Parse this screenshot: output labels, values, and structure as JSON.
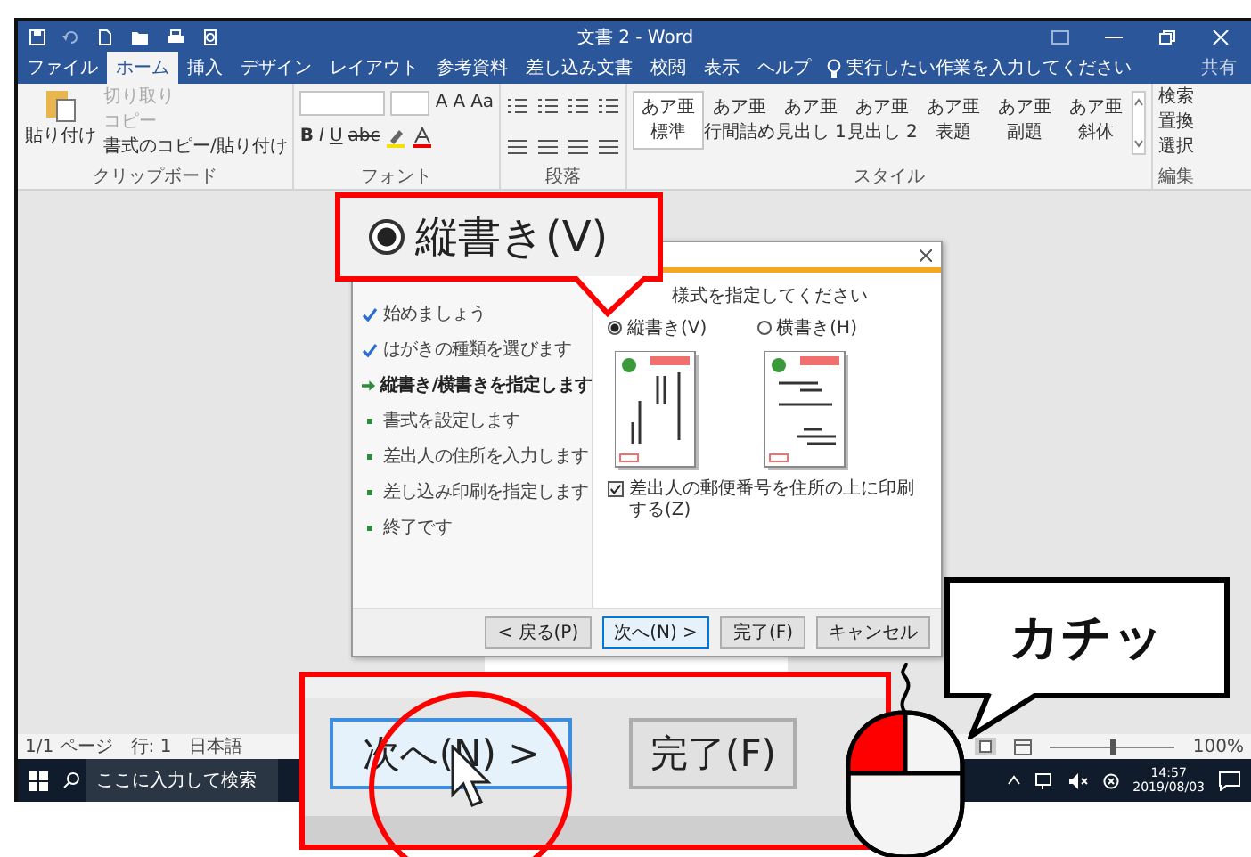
{
  "title_bar": {
    "title": "文書 2 - Word"
  },
  "ribbon_tabs": [
    {
      "label": "ファイル",
      "selected": false
    },
    {
      "label": "ホーム",
      "selected": true
    },
    {
      "label": "挿入",
      "selected": false
    },
    {
      "label": "デザイン",
      "selected": false
    },
    {
      "label": "レイアウト",
      "selected": false
    },
    {
      "label": "参考資料",
      "selected": false
    },
    {
      "label": "差し込み文書",
      "selected": false
    },
    {
      "label": "校閲",
      "selected": false
    },
    {
      "label": "表示",
      "selected": false
    },
    {
      "label": "ヘルプ",
      "selected": false
    }
  ],
  "tell_me": {
    "placeholder": "実行したい作業を入力してください"
  },
  "share": "共有",
  "clipboard": {
    "paste": "貼り付け",
    "label": "クリップボード",
    "items": [
      {
        "label": "切り取り",
        "disabled": true
      },
      {
        "label": "コピー",
        "disabled": true
      },
      {
        "label": "書式のコピー/貼り付け",
        "disabled": false
      }
    ]
  },
  "font": {
    "label": "フォント",
    "size_buttons": [
      "A",
      "A",
      "Aa"
    ],
    "buttons": [
      "B",
      "I",
      "U",
      "abc"
    ]
  },
  "paragraph": {
    "label": "段落"
  },
  "styles": {
    "label": "スタイル",
    "items": [
      {
        "sample": "あア亜",
        "name": "標準",
        "selected": true
      },
      {
        "sample": "あア亜",
        "name": "行間詰め",
        "selected": false
      },
      {
        "sample": "あア亜",
        "name": "見出し 1",
        "selected": false
      },
      {
        "sample": "あア亜",
        "name": "見出し 2",
        "selected": false
      },
      {
        "sample": "あア亜",
        "name": "表題",
        "selected": false
      },
      {
        "sample": "あア亜",
        "name": "副題",
        "selected": false
      },
      {
        "sample": "あア亜",
        "name": "斜体",
        "selected": false
      }
    ]
  },
  "editing": {
    "label": "編集",
    "items": [
      "検索",
      "置換",
      "選択"
    ]
  },
  "dialog": {
    "steps": [
      {
        "label": "始めましょう",
        "kind": "done"
      },
      {
        "label": "はがきの種類を選びます",
        "kind": "done"
      },
      {
        "label": "縦書き/横書きを指定します",
        "kind": "current"
      },
      {
        "label": "書式を設定します",
        "kind": "pending"
      },
      {
        "label": "差出人の住所を入力します",
        "kind": "pending"
      },
      {
        "label": "差し込み印刷を指定します",
        "kind": "pending"
      },
      {
        "label": "終了です",
        "kind": "pending"
      }
    ],
    "prompt": "様式を指定してください",
    "options": [
      {
        "label": "縦書き(V)",
        "selected": true,
        "kind": "vertical"
      },
      {
        "label": "横書き(H)",
        "selected": false,
        "kind": "horizontal"
      }
    ],
    "checkbox": {
      "label": "差出人の郵便番号を住所の上に印刷する(Z)",
      "checked": true
    },
    "buttons": [
      {
        "label": "< 戻る(P)",
        "focused": false
      },
      {
        "label": "次へ(N) >",
        "focused": true
      },
      {
        "label": "完了(F)",
        "focused": false
      },
      {
        "label": "キャンセル",
        "focused": false
      }
    ]
  },
  "status_bar": {
    "page": "1/1 ページ",
    "line": "行: 1",
    "language": "日本語",
    "zoom_slider": {
      "level": 0.5
    },
    "zoom": "100%"
  },
  "taskbar": {
    "search": {
      "placeholder": "ここに入力して検索"
    },
    "time": "14:57",
    "date": "2019/08/03"
  },
  "callouts": {
    "option": {
      "label": "縦書き(V)",
      "selected": true
    },
    "zoomed_buttons": [
      {
        "label": "次へ(N) >",
        "focused": true
      },
      {
        "label": "完了(F)",
        "focused": false
      }
    ],
    "sound": "カチッ",
    "mouse": {
      "left_pressed": true
    }
  }
}
